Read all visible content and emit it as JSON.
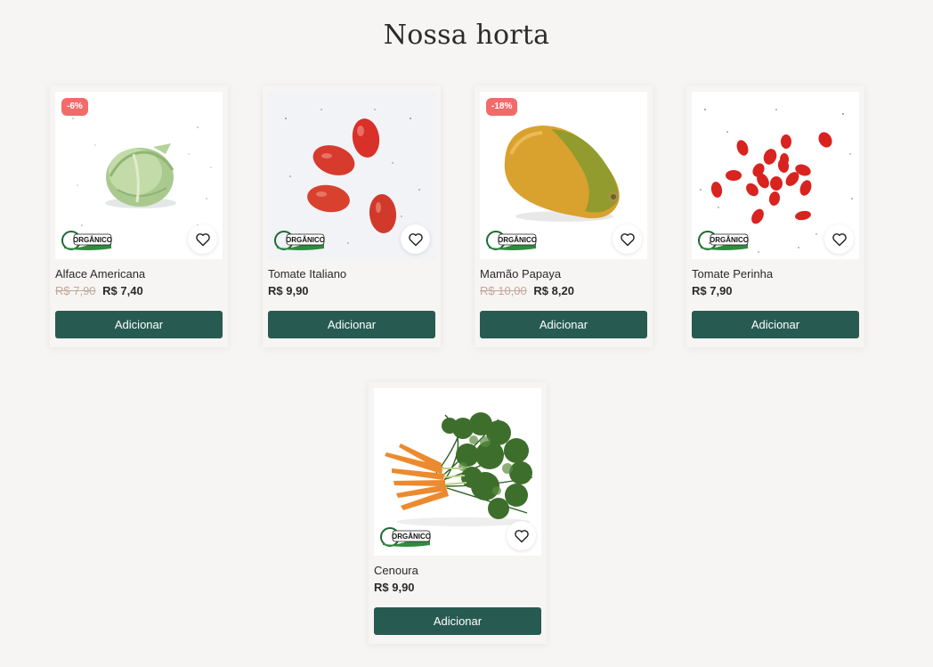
{
  "section": {
    "title": "Nossa horta"
  },
  "colors": {
    "button": "#275b52",
    "badge": "#f26b6b",
    "background": "#f7f5f3",
    "old_price": "#c2a79a"
  },
  "products": [
    {
      "name": "Alface Americana",
      "old_price": "R$ 7,90",
      "price": "R$ 7,40",
      "badge": "-6%",
      "button": "Adicionar",
      "seal": "ORGÂNICO BRASIL",
      "favorite_icon": "heart-icon"
    },
    {
      "name": "Tomate Italiano",
      "old_price": "",
      "price": "R$ 9,90",
      "badge": "",
      "button": "Adicionar",
      "seal": "ORGÂNICO BRASIL",
      "favorite_icon": "heart-icon"
    },
    {
      "name": "Mamão Papaya",
      "old_price": "R$ 10,00",
      "price": "R$ 8,20",
      "badge": "-18%",
      "button": "Adicionar",
      "seal": "ORGÂNICO BRASIL",
      "favorite_icon": "heart-icon"
    },
    {
      "name": "Tomate Perinha",
      "old_price": "",
      "price": "R$ 7,90",
      "badge": "",
      "button": "Adicionar",
      "seal": "ORGÂNICO BRASIL",
      "favorite_icon": "heart-icon"
    },
    {
      "name": "Cenoura",
      "old_price": "",
      "price": "R$ 9,90",
      "badge": "",
      "button": "Adicionar",
      "seal": "ORGÂNICO BRASIL",
      "favorite_icon": "heart-icon"
    }
  ]
}
